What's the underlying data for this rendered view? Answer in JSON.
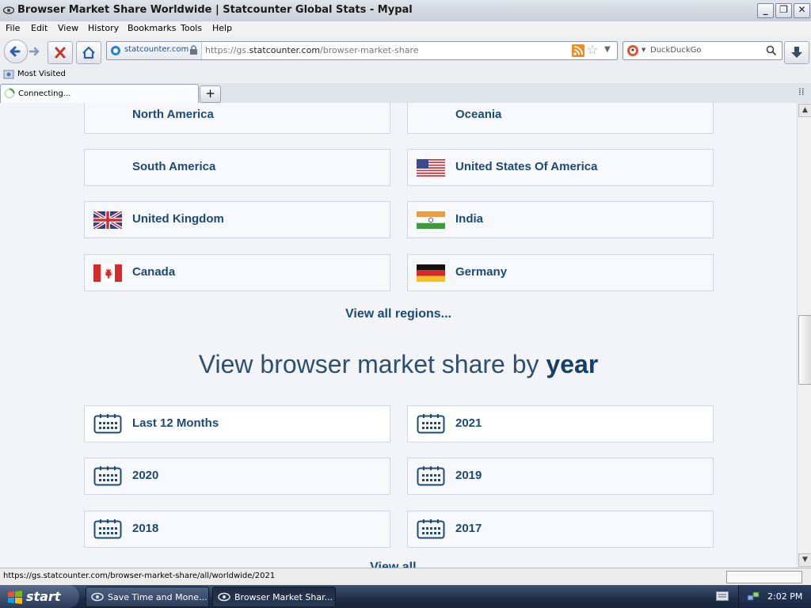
{
  "window": {
    "title": "Browser Market Share Worldwide | Statcounter Global Stats - Mypal",
    "controls": [
      "minimize",
      "restore",
      "close"
    ]
  },
  "menu": [
    "File",
    "Edit",
    "View",
    "History",
    "Bookmarks",
    "Tools",
    "Help"
  ],
  "navbar": {
    "identity": "statcounter.com",
    "url_prefix": "https://gs.",
    "url_domain": "statcounter.com",
    "url_path": "/browser-market-share",
    "search_placeholder": "DuckDuckGo"
  },
  "bookmarks": {
    "items": [
      "Most Visited"
    ]
  },
  "tabs": [
    {
      "label": "Connecting..."
    }
  ],
  "content": {
    "regions": [
      {
        "label": "North America",
        "flag": ""
      },
      {
        "label": "Oceania",
        "flag": ""
      },
      {
        "label": "South America",
        "flag": ""
      },
      {
        "label": "United States Of America",
        "flag": "us-flag"
      },
      {
        "label": "United Kingdom",
        "flag": "uk-flag"
      },
      {
        "label": "India",
        "flag": "india-flag"
      },
      {
        "label": "Canada",
        "flag": "canada-flag"
      },
      {
        "label": "Germany",
        "flag": "germany-flag"
      }
    ],
    "view_all_regions": "View all regions...",
    "heading_prefix": "View browser market share by ",
    "heading_bold": "year",
    "years": [
      {
        "label": "Last 12 Months"
      },
      {
        "label": "2021"
      },
      {
        "label": "2020"
      },
      {
        "label": "2019"
      },
      {
        "label": "2018"
      },
      {
        "label": "2017"
      }
    ],
    "partial_link": "View all..."
  },
  "statusbar": {
    "text": "https://gs.statcounter.com/browser-market-share/all/worldwide/2021"
  },
  "taskbar": {
    "start": "start",
    "tasks": [
      "Save Time and Mone...",
      "Browser Market Shar..."
    ],
    "clock": "2:02 PM"
  },
  "colors": {
    "link": "#1d4a74",
    "heading": "#2f4f6e",
    "content_bg": "#f2f4f8"
  }
}
